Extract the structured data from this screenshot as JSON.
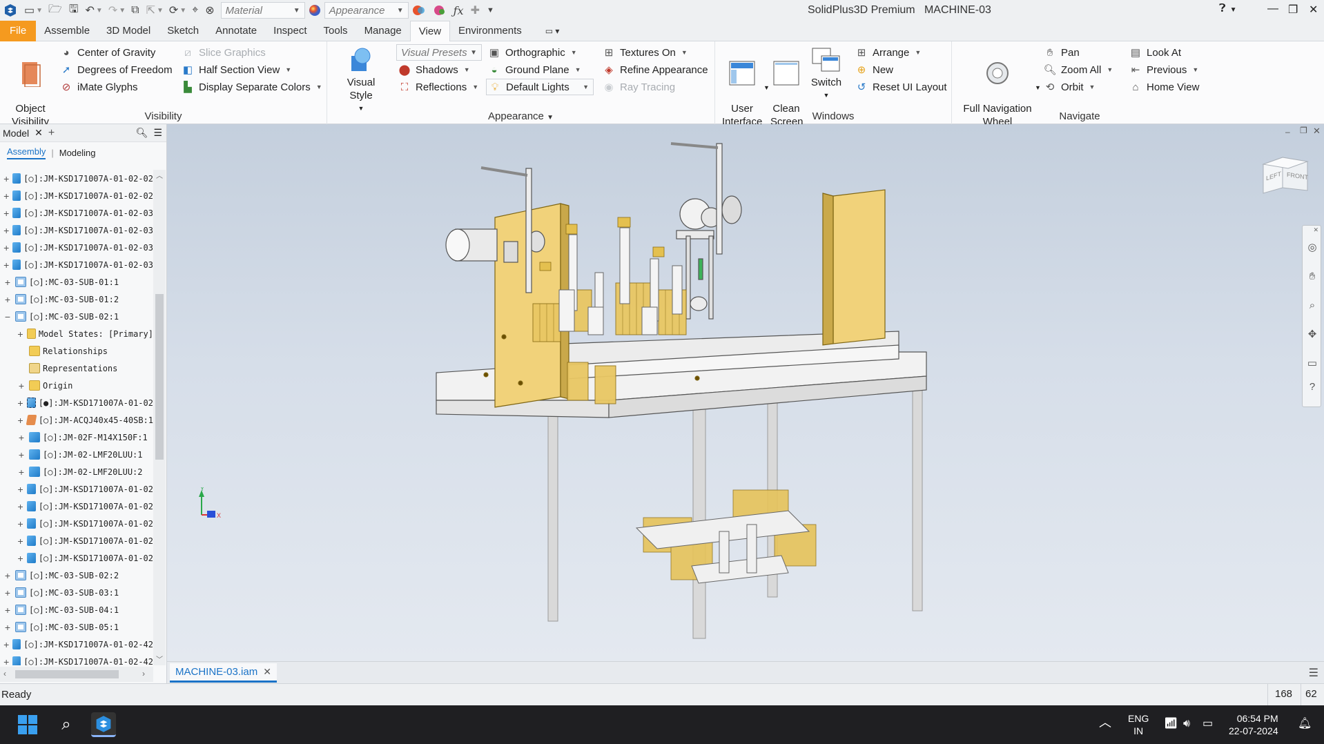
{
  "app": {
    "title": "SolidPlus3D Premium",
    "document": "MACHINE-03",
    "material_placeholder": "Material",
    "appearance_placeholder": "Appearance"
  },
  "menu": [
    "File",
    "Assemble",
    "3D Model",
    "Sketch",
    "Annotate",
    "Inspect",
    "Tools",
    "Manage",
    "View",
    "Environments"
  ],
  "ribbon": {
    "visibility": {
      "title": "Visibility",
      "object_visibility": "Object\nVisibility",
      "center_of_gravity": "Center of Gravity",
      "degrees_of_freedom": "Degrees of Freedom",
      "imate_glyphs": "iMate Glyphs",
      "slice_graphics": "Slice Graphics",
      "half_section_view": "Half Section View",
      "display_separate_colors": "Display Separate Colors"
    },
    "appearance": {
      "title": "Appearance",
      "visual_style": "Visual Style",
      "visual_presets": "Visual Presets",
      "shadows": "Shadows",
      "reflections": "Reflections",
      "orthographic": "Orthographic",
      "ground_plane": "Ground Plane",
      "default_lights": "Default Lights",
      "textures_on": "Textures On",
      "refine_appearance": "Refine Appearance",
      "ray_tracing": "Ray Tracing"
    },
    "windows": {
      "title": "Windows",
      "user_interface": "User\nInterface",
      "clean_screen": "Clean\nScreen",
      "switch": "Switch",
      "arrange": "Arrange",
      "new": "New",
      "reset_ui_layout": "Reset UI Layout"
    },
    "navigate": {
      "title": "Navigate",
      "full_navigation_wheel": "Full Navigation\nWheel",
      "pan": "Pan",
      "zoom_all": "Zoom All",
      "orbit": "Orbit",
      "look_at": "Look At",
      "previous": "Previous",
      "home_view": "Home View"
    }
  },
  "browser": {
    "tab": "Model",
    "sub_tabs": [
      "Assembly",
      "Modeling"
    ],
    "nodes": [
      {
        "indent": 0,
        "expander": "+",
        "icon": "part",
        "label": "[○]:JM-KSD171007A-01-02-02"
      },
      {
        "indent": 0,
        "expander": "+",
        "icon": "part",
        "label": "[○]:JM-KSD171007A-01-02-02"
      },
      {
        "indent": 0,
        "expander": "+",
        "icon": "part",
        "label": "[○]:JM-KSD171007A-01-02-03"
      },
      {
        "indent": 0,
        "expander": "+",
        "icon": "part",
        "label": "[○]:JM-KSD171007A-01-02-03"
      },
      {
        "indent": 0,
        "expander": "+",
        "icon": "part",
        "label": "[○]:JM-KSD171007A-01-02-03"
      },
      {
        "indent": 0,
        "expander": "+",
        "icon": "part",
        "label": "[○]:JM-KSD171007A-01-02-03"
      },
      {
        "indent": 0,
        "expander": "+",
        "icon": "asm",
        "label": "[○]:MC-03-SUB-01:1"
      },
      {
        "indent": 0,
        "expander": "+",
        "icon": "asm",
        "label": "[○]:MC-03-SUB-01:2"
      },
      {
        "indent": 0,
        "expander": "−",
        "icon": "asm",
        "label": "[○]:MC-03-SUB-02:1"
      },
      {
        "indent": 1,
        "expander": "+",
        "icon": "folder",
        "label": "Model States: [Primary]"
      },
      {
        "indent": 1,
        "expander": "",
        "icon": "folder",
        "label": "Relationships"
      },
      {
        "indent": 1,
        "expander": "",
        "icon": "repr",
        "label": "Representations"
      },
      {
        "indent": 1,
        "expander": "+",
        "icon": "folder",
        "label": "Origin"
      },
      {
        "indent": 1,
        "expander": "+",
        "icon": "edit",
        "label": "[●]:JM-KSD171007A-01-02"
      },
      {
        "indent": 1,
        "expander": "+",
        "icon": "orange",
        "label": "[○]:JM-ACQJ40x45-40SB:1"
      },
      {
        "indent": 1,
        "expander": "+",
        "icon": "part",
        "label": "[○]:JM-02F-M14X150F:1"
      },
      {
        "indent": 1,
        "expander": "+",
        "icon": "part",
        "label": "[○]:JM-02-LMF20LUU:1"
      },
      {
        "indent": 1,
        "expander": "+",
        "icon": "part",
        "label": "[○]:JM-02-LMF20LUU:2"
      },
      {
        "indent": 1,
        "expander": "+",
        "icon": "part",
        "label": "[○]:JM-KSD171007A-01-02"
      },
      {
        "indent": 1,
        "expander": "+",
        "icon": "part",
        "label": "[○]:JM-KSD171007A-01-02"
      },
      {
        "indent": 1,
        "expander": "+",
        "icon": "part",
        "label": "[○]:JM-KSD171007A-01-02"
      },
      {
        "indent": 1,
        "expander": "+",
        "icon": "part",
        "label": "[○]:JM-KSD171007A-01-02"
      },
      {
        "indent": 1,
        "expander": "+",
        "icon": "part",
        "label": "[○]:JM-KSD171007A-01-02"
      },
      {
        "indent": 0,
        "expander": "+",
        "icon": "asm",
        "label": "[○]:MC-03-SUB-02:2"
      },
      {
        "indent": 0,
        "expander": "+",
        "icon": "asm",
        "label": "[○]:MC-03-SUB-03:1"
      },
      {
        "indent": 0,
        "expander": "+",
        "icon": "asm",
        "label": "[○]:MC-03-SUB-04:1"
      },
      {
        "indent": 0,
        "expander": "+",
        "icon": "asm",
        "label": "[○]:MC-03-SUB-05:1"
      },
      {
        "indent": 0,
        "expander": "+",
        "icon": "part",
        "label": "[○]:JM-KSD171007A-01-02-42"
      },
      {
        "indent": 0,
        "expander": "+",
        "icon": "part",
        "label": "[○]:JM-KSD171007A-01-02-42"
      }
    ]
  },
  "viewcube": {
    "left": "LEFT",
    "front": "FRONT"
  },
  "doc_tab": "MACHINE-03.iam",
  "status": {
    "text": "Ready",
    "count1": "168",
    "count2": "62"
  },
  "taskbar": {
    "lang_top": "ENG",
    "lang_bottom": "IN",
    "time": "06:54 PM",
    "date": "22-07-2024"
  },
  "colors": {
    "file_tab": "#f59a1f",
    "accent": "#1a73c7",
    "model_yellow": "#f1d27a",
    "model_white": "#f2f2f2"
  }
}
